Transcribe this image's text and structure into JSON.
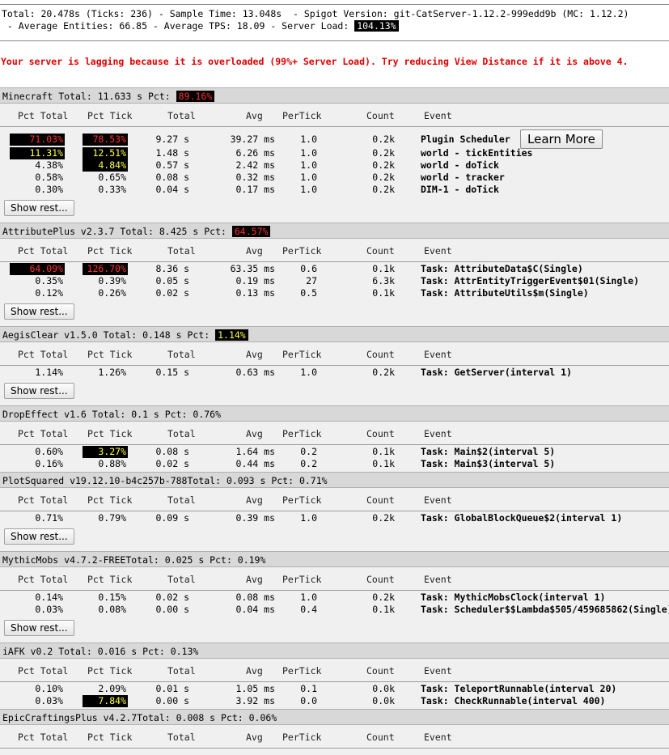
{
  "summary": {
    "line1": "Total: 20.478s (Ticks: 236) - Sample Time: 13.048s  - Spigot Version: git-CatServer-1.12.2-999edd9b (MC: 1.12.2)",
    "line2_prefix": " - Average Entities: 66.85 - Average TPS: 18.09 - Server Load: ",
    "server_load": "104.13%"
  },
  "warning": "Your server is lagging because it is overloaded (99%+ Server Load). Try reducing View Distance if it is above 4.",
  "columns": {
    "pct_total": "Pct Total",
    "pct_tick": "Pct Tick",
    "total": "Total",
    "avg": "Avg",
    "per_tick": "PerTick",
    "count": "Count",
    "event": "Event"
  },
  "show_rest_label": "Show rest...",
  "learn_more_label": "Learn More",
  "plugins": [
    {
      "title_prefix": "Minecraft Total: 11.633 s Pct: ",
      "pct": "89.16%",
      "rows": [
        {
          "pct_total": "71.03%",
          "pct_tick": "78.53%",
          "total": "9.27 s",
          "avg": "39.27 ms",
          "per_tick": "1.0",
          "count": "0.2k",
          "event": "Plugin Scheduler"
        },
        {
          "pct_total": "11.31%",
          "pct_tick": "12.51%",
          "total": "1.48 s",
          "avg": "6.26 ms",
          "per_tick": "1.0",
          "count": "0.2k",
          "event": "world - tickEntities"
        },
        {
          "pct_total": "4.38%",
          "pct_tick": "4.84%",
          "total": "0.57 s",
          "avg": "2.42 ms",
          "per_tick": "1.0",
          "count": "0.2k",
          "event": "world - doTick"
        },
        {
          "pct_total": "0.58%",
          "pct_tick": "0.65%",
          "total": "0.08 s",
          "avg": "0.32 ms",
          "per_tick": "1.0",
          "count": "0.2k",
          "event": "world - tracker"
        },
        {
          "pct_total": "0.30%",
          "pct_tick": "0.33%",
          "total": "0.04 s",
          "avg": "0.17 ms",
          "per_tick": "1.0",
          "count": "0.2k",
          "event": "DIM-1 - doTick"
        }
      ]
    },
    {
      "title_prefix": "AttributePlus v2.3.7 Total: 8.425 s Pct: ",
      "pct": "64.57%",
      "rows": [
        {
          "pct_total": "64.09%",
          "pct_tick": "126.70%",
          "total": "8.36 s",
          "avg": "63.35 ms",
          "per_tick": "0.6",
          "count": "0.1k",
          "event": "Task: AttributeData$C(Single)"
        },
        {
          "pct_total": "0.35%",
          "pct_tick": "0.39%",
          "total": "0.05 s",
          "avg": "0.19 ms",
          "per_tick": "27",
          "count": "6.3k",
          "event": "Task: AttrEntityTriggerEvent$01(Single)"
        },
        {
          "pct_total": "0.12%",
          "pct_tick": "0.26%",
          "total": "0.02 s",
          "avg": "0.13 ms",
          "per_tick": "0.5",
          "count": "0.1k",
          "event": "Task: AttributeUtils$m(Single)"
        }
      ]
    },
    {
      "title_prefix": "AegisClear v1.5.0 Total: 0.148 s Pct: ",
      "pct": "1.14%",
      "rows": [
        {
          "pct_total": "1.14%",
          "pct_tick": "1.26%",
          "total": "0.15 s",
          "avg": "0.63 ms",
          "per_tick": "1.0",
          "count": "0.2k",
          "event": "Task: GetServer(interval 1)"
        }
      ]
    },
    {
      "title_prefix": "DropEffect v1.6 Total: 0.1 s Pct: 0.76%",
      "pct": "",
      "rows": [
        {
          "pct_total": "0.60%",
          "pct_tick": "3.27%",
          "total": "0.08 s",
          "avg": "1.64 ms",
          "per_tick": "0.2",
          "count": "0.1k",
          "event": "Task: Main$2(interval 5)"
        },
        {
          "pct_total": "0.16%",
          "pct_tick": "0.88%",
          "total": "0.02 s",
          "avg": "0.44 ms",
          "per_tick": "0.2",
          "count": "0.1k",
          "event": "Task: Main$3(interval 5)"
        }
      ]
    },
    {
      "title_prefix": "PlotSquared v19.12.10-b4c257b-788Total: 0.093 s Pct: 0.71%",
      "pct": "",
      "rows": [
        {
          "pct_total": "0.71%",
          "pct_tick": "0.79%",
          "total": "0.09 s",
          "avg": "0.39 ms",
          "per_tick": "1.0",
          "count": "0.2k",
          "event": "Task: GlobalBlockQueue$2(interval 1)"
        }
      ]
    },
    {
      "title_prefix": "MythicMobs v4.7.2-FREETotal: 0.025 s Pct: 0.19%",
      "pct": "",
      "rows": [
        {
          "pct_total": "0.14%",
          "pct_tick": "0.15%",
          "total": "0.02 s",
          "avg": "0.08 ms",
          "per_tick": "1.0",
          "count": "0.2k",
          "event": "Task: MythicMobsClock(interval 1)"
        },
        {
          "pct_total": "0.03%",
          "pct_tick": "0.08%",
          "total": "0.00 s",
          "avg": "0.04 ms",
          "per_tick": "0.4",
          "count": "0.1k",
          "event": "Task: Scheduler$$Lambda$505/459685862(Single)"
        }
      ]
    },
    {
      "title_prefix": "iAFK v0.2 Total: 0.016 s Pct: 0.13%",
      "pct": "",
      "rows": [
        {
          "pct_total": "0.10%",
          "pct_tick": "2.09%",
          "total": "0.01 s",
          "avg": "1.05 ms",
          "per_tick": "0.1",
          "count": "0.0k",
          "event": "Task: TeleportRunnable(interval 20)"
        },
        {
          "pct_total": "0.03%",
          "pct_tick": "7.84%",
          "total": "0.00 s",
          "avg": "3.92 ms",
          "per_tick": "0.0",
          "count": "0.0k",
          "event": "Task: CheckRunnable(interval 400)"
        }
      ]
    },
    {
      "title_prefix": "EpicCraftingsPlus v4.2.7Total: 0.008 s Pct: 0.06%",
      "pct": "",
      "rows": []
    }
  ]
}
